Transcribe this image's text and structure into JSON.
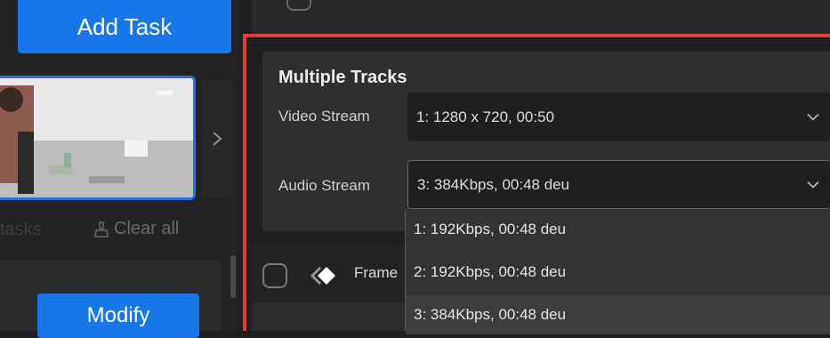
{
  "left": {
    "add_task_label": "Add Task",
    "tasks_label": "tasks",
    "clear_all_label": "Clear all",
    "modify_label": "Modify"
  },
  "tracks": {
    "title": "Multiple Tracks",
    "video_label": "Video Stream",
    "video_value": "1: 1280 x 720,  00:50",
    "audio_label": "Audio Stream",
    "audio_value": "3: 384Kbps,  00:48  deu",
    "audio_options": [
      "1: 192Kbps,  00:48  deu",
      "2: 192Kbps,  00:48  deu",
      "3: 384Kbps,  00:48  deu"
    ],
    "audio_selected_index": 2
  },
  "frame_option": {
    "label": "Frame"
  },
  "colors": {
    "accent": "#1777e8",
    "highlight_border": "#e23c3c",
    "background": "#1f1f21",
    "panel": "#2f2f31"
  },
  "icons": {
    "chevron": "chevron-down-icon",
    "next": "chevron-right-icon",
    "clear": "broom-icon",
    "frame": "frame-interpolation-icon"
  }
}
